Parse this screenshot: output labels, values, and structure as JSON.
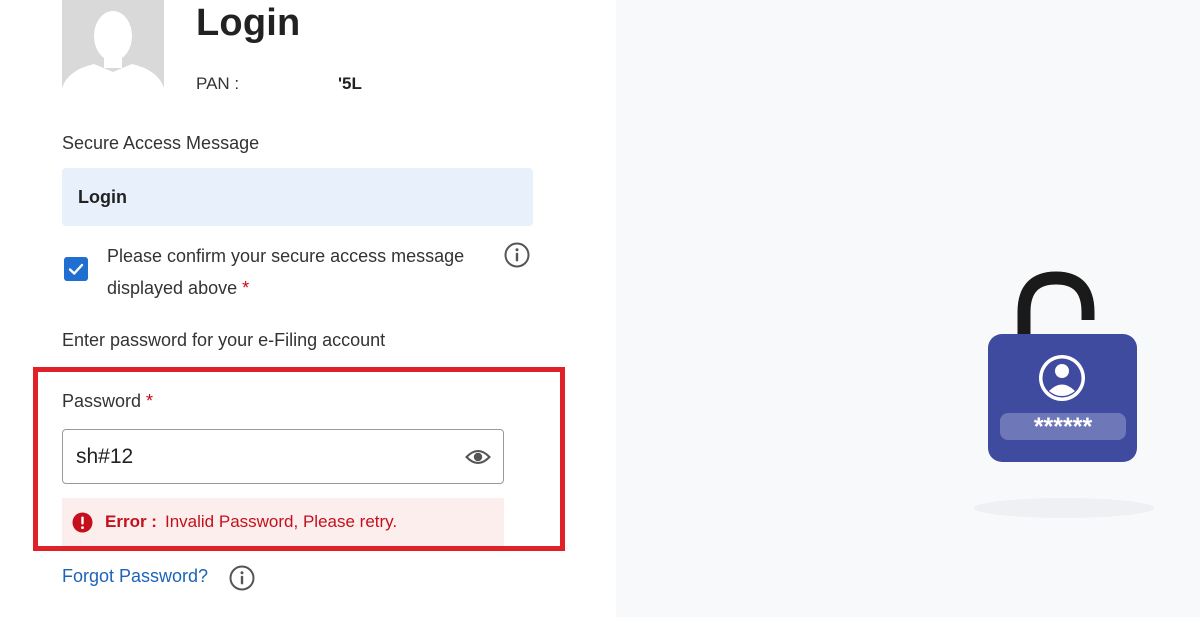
{
  "header": {
    "title": "Login",
    "pan_label": "PAN :",
    "pan_value": "'5L"
  },
  "secure_access": {
    "label": "Secure Access Message",
    "message": "Login",
    "confirm_text": "Please confirm your secure access message displayed above",
    "confirm_required": "*",
    "checked": true
  },
  "password_section": {
    "intro": "Enter password for your e-Filing account",
    "label": "Password",
    "required": "*",
    "value": "sh#12",
    "error_label": "Error :",
    "error_message": "Invalid Password, Please retry."
  },
  "links": {
    "forgot_password": "Forgot Password?"
  },
  "illustration": {
    "masked_text": "******"
  },
  "icons": {
    "avatar": "user-silhouette",
    "info": "info-circle-icon",
    "eye": "eye-icon",
    "error": "exclamation-circle-icon",
    "lock": "unlocked-padlock-icon",
    "checkbox": "checkmark-icon"
  },
  "colors": {
    "primary_blue": "#1e6fd0",
    "link_blue": "#1d63b8",
    "error_red": "#c4101c",
    "highlight_red": "#e02127",
    "lock_body": "#3f4b9e",
    "message_box": "#e8f0fc"
  }
}
